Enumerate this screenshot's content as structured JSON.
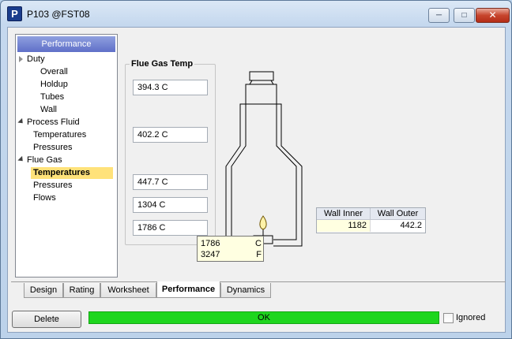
{
  "window": {
    "title": "P103 @FST08",
    "icon_letter": "P",
    "controls": {
      "minimize": "minimize-icon",
      "maximize": "maximize-icon",
      "close": "close-icon"
    }
  },
  "tree": {
    "header": "Performance",
    "items": [
      {
        "label": "Duty",
        "level": 0,
        "expander": "collapsed"
      },
      {
        "label": "Overall",
        "level": 2
      },
      {
        "label": "Holdup",
        "level": 2
      },
      {
        "label": "Tubes",
        "level": 2
      },
      {
        "label": "Wall",
        "level": 2
      },
      {
        "label": "Process Fluid",
        "level": 0,
        "expander": "expanded"
      },
      {
        "label": "Temperatures",
        "level": 1
      },
      {
        "label": "Pressures",
        "level": 1
      },
      {
        "label": "Flue Gas",
        "level": 0,
        "expander": "expanded"
      },
      {
        "label": "Temperatures",
        "level": 1,
        "selected": true
      },
      {
        "label": "Pressures",
        "level": 1
      },
      {
        "label": "Flows",
        "level": 1
      }
    ]
  },
  "flue_gas": {
    "label": "Flue Gas Temp",
    "temps": [
      "394.3 C",
      "402.2 C",
      "447.7 C",
      "1304 C",
      "1786 C"
    ]
  },
  "tooltip": {
    "rows": [
      {
        "value": "1786",
        "unit": "C"
      },
      {
        "value": "3247",
        "unit": "F"
      }
    ]
  },
  "wall_table": {
    "headers": [
      "Wall Inner",
      "Wall Outer"
    ],
    "values": [
      "1182",
      "442.2"
    ]
  },
  "tabs": [
    {
      "label": "Design",
      "active": false
    },
    {
      "label": "Rating",
      "active": false
    },
    {
      "label": "Worksheet",
      "active": false
    },
    {
      "label": "Performance",
      "active": true
    },
    {
      "label": "Dynamics",
      "active": false
    }
  ],
  "footer": {
    "delete_label": "Delete",
    "status_text": "OK",
    "status_color": "#1ed61e",
    "ignored_label": "Ignored",
    "ignored_checked": false
  }
}
